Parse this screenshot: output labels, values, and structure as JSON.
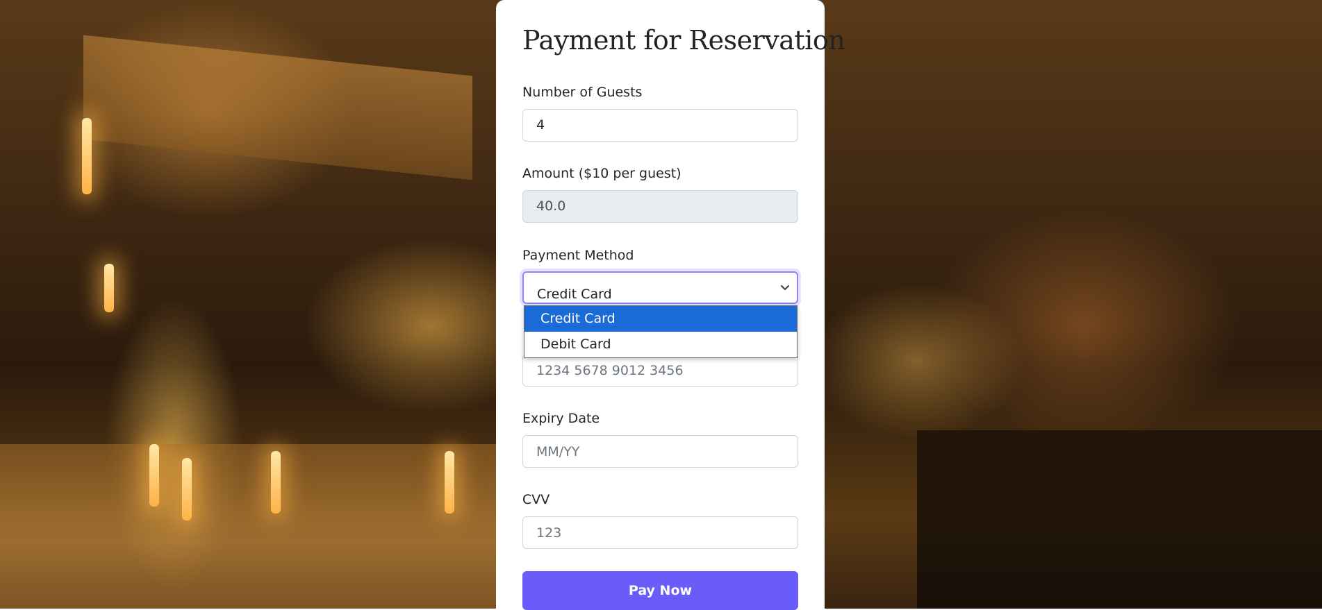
{
  "page": {
    "title": "Payment for Reservation"
  },
  "form": {
    "guests": {
      "label": "Number of Guests",
      "value": "4"
    },
    "amount": {
      "label": "Amount ($10 per guest)",
      "value": "40.0"
    },
    "payment_method": {
      "label": "Payment Method",
      "selected": "Credit Card",
      "options": [
        "Credit Card",
        "Debit Card"
      ]
    },
    "card_number": {
      "placeholder": "1234 5678 9012 3456"
    },
    "expiry": {
      "label": "Expiry Date",
      "placeholder": "MM/YY"
    },
    "cvv": {
      "label": "CVV",
      "placeholder": "123"
    },
    "submit_label": "Pay Now"
  },
  "colors": {
    "accent": "#6a5cf9",
    "dropdown_highlight": "#1a6ad8",
    "readonly_bg": "#e9ecef"
  },
  "icons": {
    "select_arrow": "chevron-down-icon"
  }
}
